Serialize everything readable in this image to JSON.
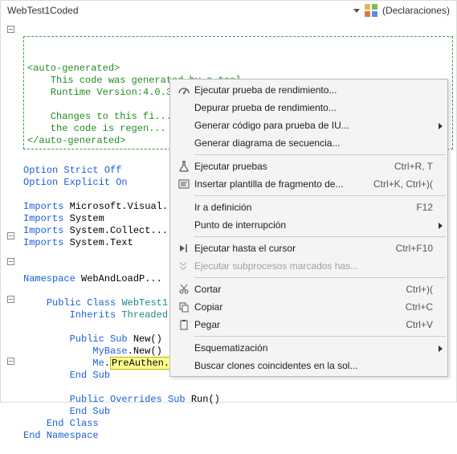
{
  "header": {
    "title": "WebTest1Coded",
    "right_label": "(Declaraciones)"
  },
  "code": {
    "autogen": {
      "open_tag": "<auto-generated>",
      "l1": "    This code was generated by a tool.",
      "l2": "    Runtime Version:4.0.30319.17361",
      "l3": "",
      "l4": "    Changes to this fi...",
      "l5": "    the code is regen...",
      "close_tag": "</auto-generated>"
    },
    "opts": {
      "strict": "Option Strict Off",
      "explicit": "Option Explicit On"
    },
    "imp": {
      "kw": "Imports",
      "t1": "Microsoft.Visual...",
      "t2": "System",
      "t3": "System.Collect...",
      "t4": "System.Text"
    },
    "ns": {
      "kw": "Namespace",
      "name": "WebAndLoadP..."
    },
    "cls": {
      "pre": "Public Class ",
      "name": "WebTest1...",
      "inh_kw": "Inherits ",
      "inh_type": "Threaded..."
    },
    "sub_new": {
      "sig_pre": "Public Sub ",
      "sig_name": "New()",
      "l1_pre": "MyBase",
      "l1_rest": ".New()",
      "l2_pre": "Me",
      "l2_dot": ".",
      "l2_name": "PreAuthen...",
      "end": "End Sub"
    },
    "sub_run": {
      "sig_pre": "Public Overrides Sub ",
      "sig_name": "Run()",
      "end": "End Sub"
    },
    "end_class": "End Class",
    "end_ns": "End Namespace"
  },
  "menu": {
    "items": [
      {
        "icon": "gauge-icon",
        "label": "Ejecutar prueba de rendimiento...",
        "shortcut": "",
        "submenu": false
      },
      {
        "icon": "",
        "label": "Depurar prueba de rendimiento...",
        "shortcut": "",
        "submenu": false
      },
      {
        "icon": "",
        "label": "Generar código para prueba de IU...",
        "shortcut": "",
        "submenu": true
      },
      {
        "icon": "",
        "label": "Generar diagrama de secuencia...",
        "shortcut": "",
        "submenu": false
      },
      {
        "sep": true
      },
      {
        "icon": "flask-icon",
        "label": "Ejecutar pruebas",
        "shortcut": "Ctrl+R, T",
        "submenu": false
      },
      {
        "icon": "snippet-icon",
        "label": "Insertar plantilla de fragmento de...",
        "shortcut": "Ctrl+K, Ctrl+)(",
        "submenu": false
      },
      {
        "sep": true
      },
      {
        "icon": "",
        "label": "Ir a definición",
        "shortcut": "F12",
        "submenu": false
      },
      {
        "icon": "",
        "label": "Punto de interrupción",
        "shortcut": "",
        "submenu": true
      },
      {
        "sep": true
      },
      {
        "icon": "run-to-icon",
        "label": "Ejecutar hasta el cursor",
        "shortcut": "Ctrl+F10",
        "submenu": false
      },
      {
        "icon": "threads-icon",
        "label": "Ejecutar subprocesos marcados has...",
        "shortcut": "",
        "submenu": false,
        "disabled": true
      },
      {
        "sep": true
      },
      {
        "icon": "cut-icon",
        "label": "Cortar",
        "shortcut": "Ctrl+)(",
        "submenu": false
      },
      {
        "icon": "copy-icon",
        "label": "Copiar",
        "shortcut": "Ctrl+C",
        "submenu": false
      },
      {
        "icon": "paste-icon",
        "label": "Pegar",
        "shortcut": "Ctrl+V",
        "submenu": false
      },
      {
        "sep": true
      },
      {
        "icon": "",
        "label": "Esquematización",
        "shortcut": "",
        "submenu": true
      },
      {
        "icon": "",
        "label": "Buscar clones coincidentes en la sol...",
        "shortcut": "",
        "submenu": false
      }
    ]
  }
}
